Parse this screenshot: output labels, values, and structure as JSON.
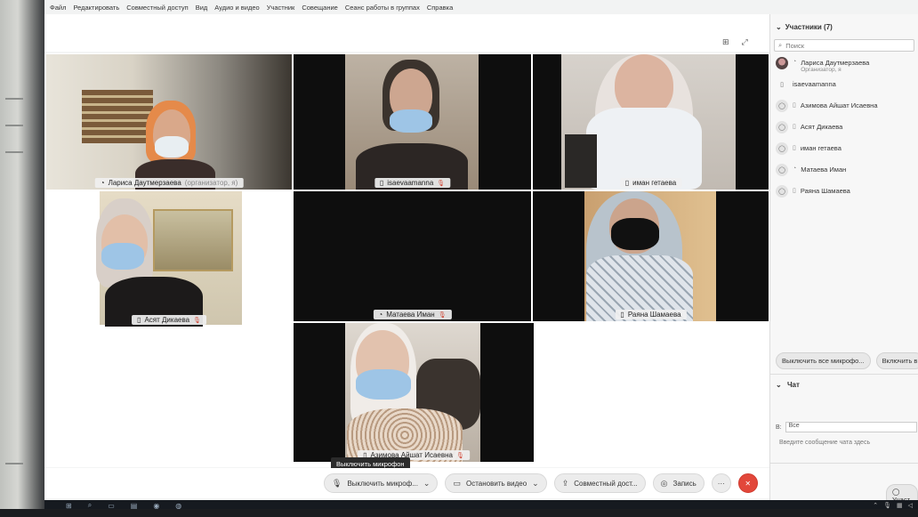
{
  "menu": [
    "Файл",
    "Редактировать",
    "Совместный доступ",
    "Вид",
    "Аудио и видео",
    "Участник",
    "Совещание",
    "Сеанс работы в группах",
    "Справка"
  ],
  "tiles": [
    {
      "name": "Лариса Даутмерзаева",
      "extra": "(организатор, я)",
      "muted": false
    },
    {
      "name": "isaevaamanna",
      "extra": "",
      "muted": true
    },
    {
      "name": "иман гетаева",
      "extra": "",
      "muted": false
    },
    {
      "name": "Асят Дикаева",
      "extra": "",
      "muted": true
    },
    {
      "name": "Матаева Иман",
      "extra": "",
      "muted": true
    },
    {
      "name": "Раяна Шамаева",
      "extra": "",
      "muted": false
    },
    {
      "name": "Азимова Айшат Исаевна",
      "extra": "",
      "muted": true
    }
  ],
  "panel": {
    "title": "Участники (7)",
    "search_placeholder": "Поиск",
    "participants": [
      {
        "name": "Лариса Даутмерзаева",
        "sub": "Организатор, я"
      },
      {
        "name": "isaevaamanna",
        "sub": ""
      },
      {
        "name": "Азимова Айшат Исаевна",
        "sub": ""
      },
      {
        "name": "Асят Дикаева",
        "sub": ""
      },
      {
        "name": "иман гетаева",
        "sub": ""
      },
      {
        "name": "Матаева Иман",
        "sub": ""
      },
      {
        "name": "Раяна Шамаева",
        "sub": ""
      }
    ],
    "mute_all": "Выключить все микрофо...",
    "unmute_all": "Включить в",
    "chat_title": "Чат",
    "chat_to_label": "В:",
    "chat_to_value": "Все",
    "chat_placeholder": "Введите сообщение чата здесь",
    "bottom_btn": "Участ"
  },
  "controls": {
    "tooltip": "Выключить микрофон",
    "mute": "Выключить микроф...",
    "video": "Остановить видео",
    "share": "Совместный дост...",
    "record": "Запись",
    "more": "···",
    "end": "✕"
  },
  "colors": {
    "accent": "#3fb0e8",
    "end": "#e2473a"
  }
}
